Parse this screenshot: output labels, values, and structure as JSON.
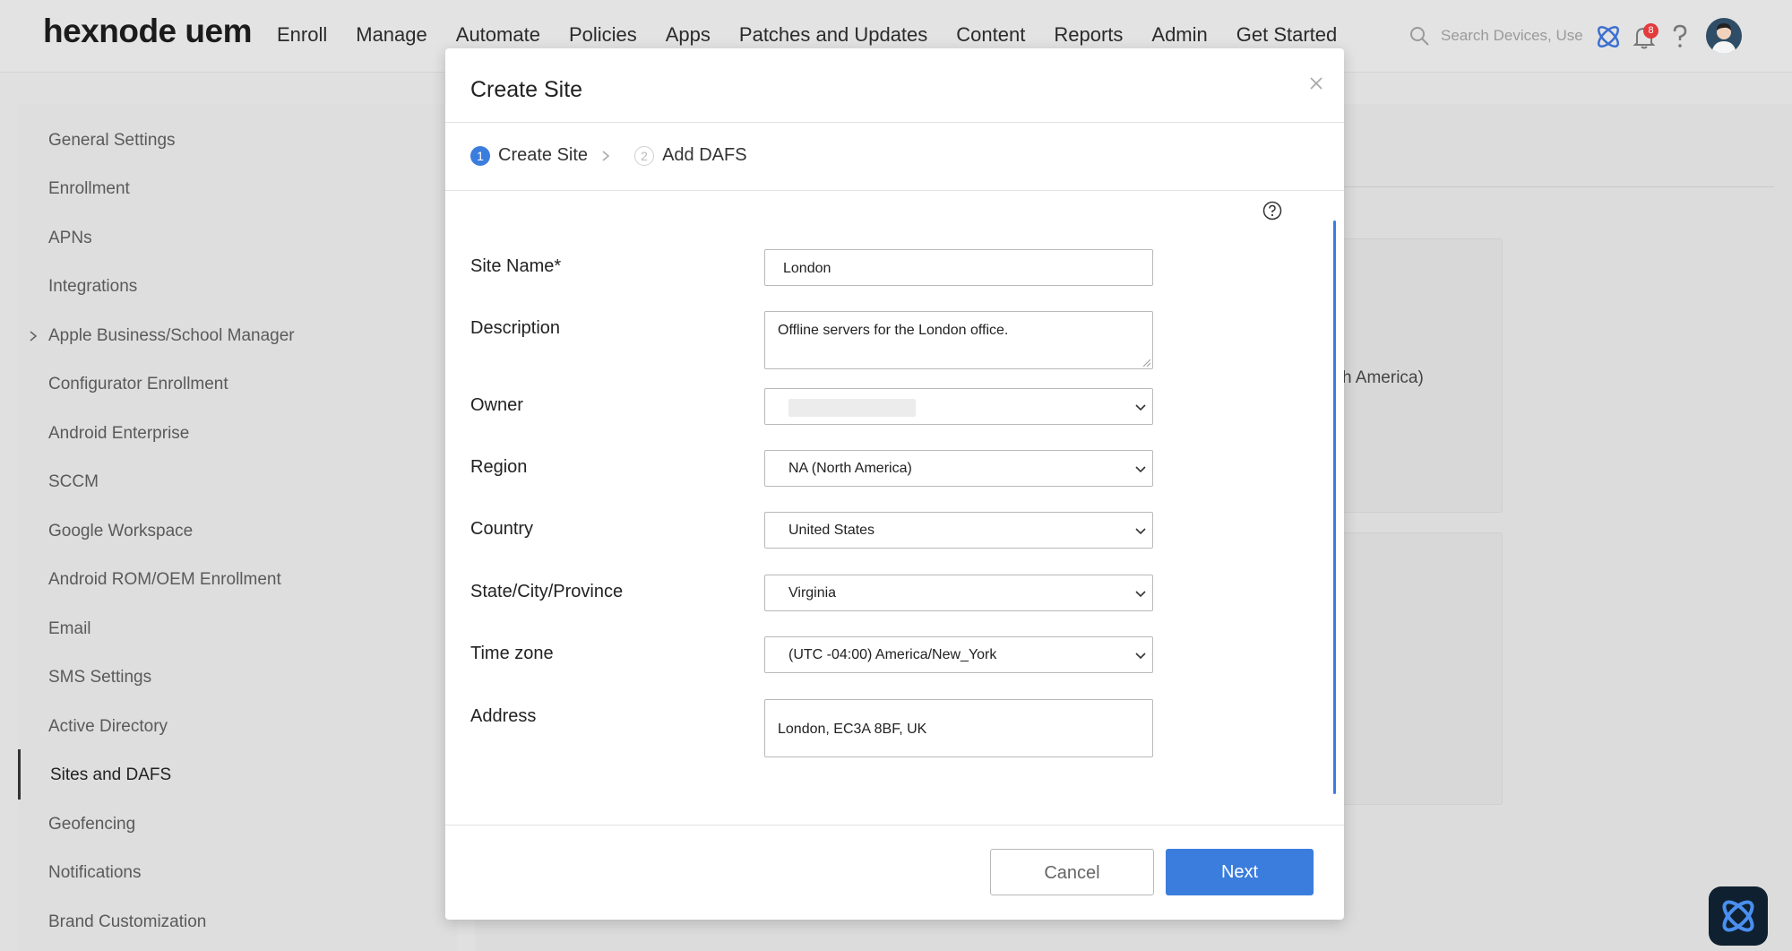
{
  "header": {
    "logo": "hexnode uem",
    "nav": [
      "Enroll",
      "Manage",
      "Automate",
      "Policies",
      "Apps",
      "Patches and Updates",
      "Content",
      "Reports",
      "Admin",
      "Get Started"
    ],
    "search_placeholder": "Search Devices, Use",
    "notification_count": "8",
    "icons": [
      "search-icon",
      "hexnode-app-icon",
      "bell-icon",
      "help-icon",
      "avatar"
    ]
  },
  "sidebar": {
    "items": [
      "General Settings",
      "Enrollment",
      "APNs",
      "Integrations",
      "Apple Business/School Manager",
      "Configurator Enrollment",
      "Android Enterprise",
      "SCCM",
      "Google Workspace",
      "Android ROM/OEM Enrollment",
      "Email",
      "SMS Settings",
      "Active Directory",
      "Sites and DAFS",
      "Geofencing",
      "Notifications",
      "Brand Customization"
    ],
    "active": "Sites and DAFS"
  },
  "background": {
    "partial_text": "h America)"
  },
  "modal": {
    "title": "Create Site",
    "steps": [
      {
        "number": "1",
        "label": "Create Site"
      },
      {
        "number": "2",
        "label": "Add DAFS"
      }
    ],
    "fields": {
      "site_name": {
        "label": "Site Name*",
        "value": "London"
      },
      "description": {
        "label": "Description",
        "value": "Offline servers for the London office."
      },
      "owner": {
        "label": "Owner",
        "value": ""
      },
      "region": {
        "label": "Region",
        "value": "NA (North America)"
      },
      "country": {
        "label": "Country",
        "value": "United States"
      },
      "state": {
        "label": "State/City/Province",
        "value": "Virginia"
      },
      "timezone": {
        "label": "Time zone",
        "value": "(UTC -04:00) America/New_York"
      },
      "address": {
        "label": "Address",
        "value": "London, EC3A 8BF, UK"
      }
    },
    "buttons": {
      "cancel": "Cancel",
      "next": "Next"
    }
  },
  "colors": {
    "accent": "#3b7ddd",
    "badge": "#e23b3b"
  }
}
